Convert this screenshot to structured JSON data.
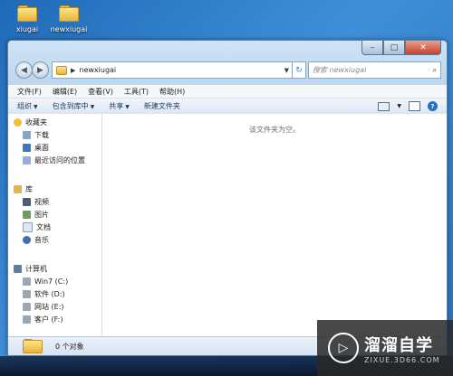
{
  "desktop": {
    "icons": [
      {
        "label": "xiugai"
      },
      {
        "label": "newxiugai"
      }
    ]
  },
  "window": {
    "address": {
      "path": "newxiugai"
    },
    "search": {
      "placeholder": "搜索 newxiugai"
    },
    "menu": [
      "文件(F)",
      "编辑(E)",
      "查看(V)",
      "工具(T)",
      "帮助(H)"
    ],
    "commands": [
      {
        "label": "组织",
        "dropdown": true
      },
      {
        "label": "包含到库中",
        "dropdown": true
      },
      {
        "label": "共享",
        "dropdown": true
      },
      {
        "label": "新建文件夹",
        "dropdown": false
      }
    ],
    "nav": {
      "favorites": {
        "title": "收藏夹",
        "items": [
          "下载",
          "桌面",
          "最近访问的位置"
        ]
      },
      "libraries": {
        "title": "库",
        "items": [
          "视频",
          "图片",
          "文档",
          "音乐"
        ]
      },
      "computer": {
        "title": "计算机",
        "items": [
          "Win7 (C:)",
          "软件 (D:)",
          "网站 (E:)",
          "客户 (F:)"
        ]
      }
    },
    "content": {
      "empty_text": "该文件夹为空。"
    },
    "status": {
      "text": "0 个对象"
    }
  },
  "watermark": {
    "brand": "溜溜自学",
    "url": "ZIXUE.3D66.COM"
  },
  "colors": {
    "desktop": "#2a70c0",
    "accent": "#2a6fc4"
  }
}
